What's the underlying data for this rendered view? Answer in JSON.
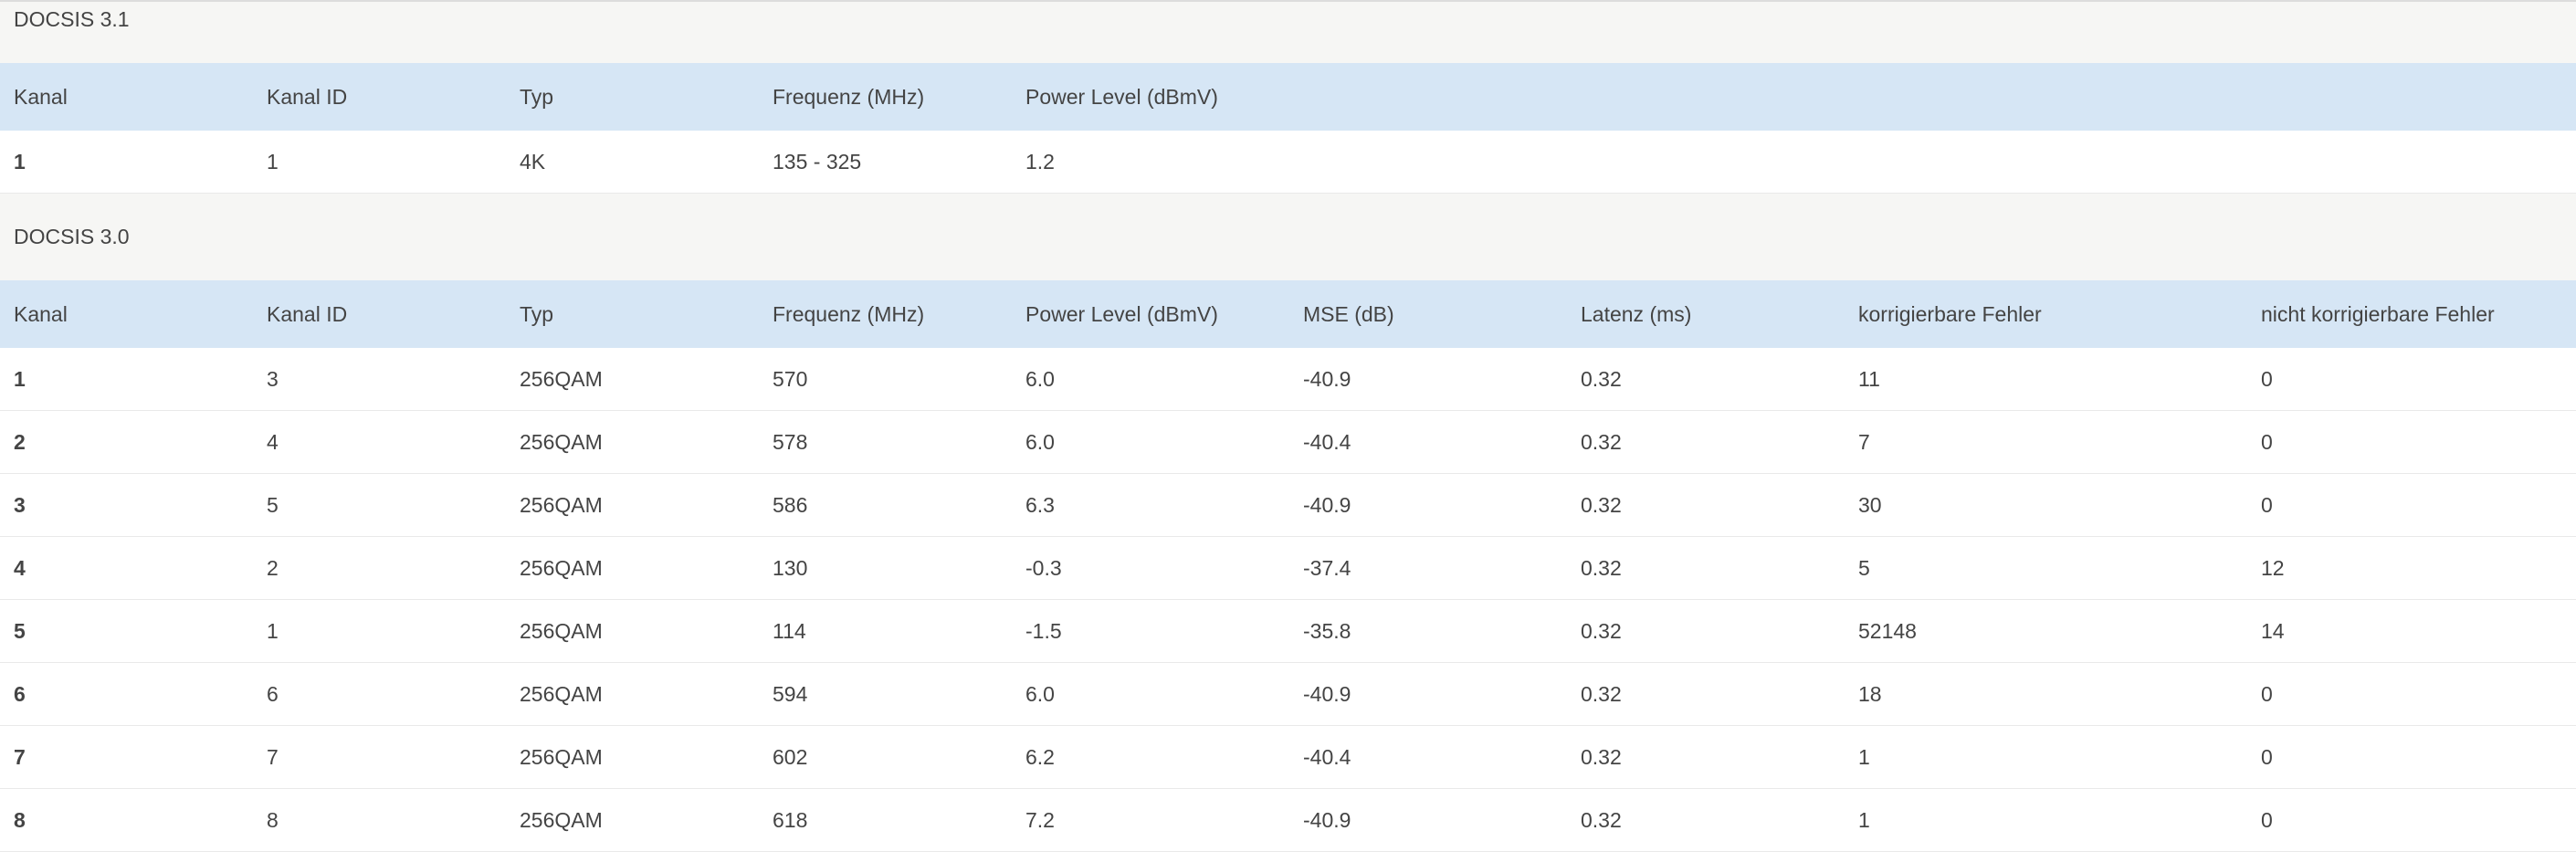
{
  "docsis31": {
    "title": "DOCSIS 3.1",
    "headers": [
      "Kanal",
      "Kanal ID",
      "Typ",
      "Frequenz (MHz)",
      "Power Level (dBmV)"
    ],
    "rows": [
      [
        "1",
        "1",
        "4K",
        "135 - 325",
        "1.2"
      ]
    ]
  },
  "docsis30": {
    "title": "DOCSIS 3.0",
    "headers": [
      "Kanal",
      "Kanal ID",
      "Typ",
      "Frequenz (MHz)",
      "Power Level (dBmV)",
      "MSE (dB)",
      "Latenz (ms)",
      "korrigierbare Fehler",
      "nicht korrigierbare Fehler"
    ],
    "rows": [
      [
        "1",
        "3",
        "256QAM",
        "570",
        "6.0",
        "-40.9",
        "0.32",
        "11",
        "0"
      ],
      [
        "2",
        "4",
        "256QAM",
        "578",
        "6.0",
        "-40.4",
        "0.32",
        "7",
        "0"
      ],
      [
        "3",
        "5",
        "256QAM",
        "586",
        "6.3",
        "-40.9",
        "0.32",
        "30",
        "0"
      ],
      [
        "4",
        "2",
        "256QAM",
        "130",
        "-0.3",
        "-37.4",
        "0.32",
        "5",
        "12"
      ],
      [
        "5",
        "1",
        "256QAM",
        "114",
        "-1.5",
        "-35.8",
        "0.32",
        "52148",
        "14"
      ],
      [
        "6",
        "6",
        "256QAM",
        "594",
        "6.0",
        "-40.9",
        "0.32",
        "18",
        "0"
      ],
      [
        "7",
        "7",
        "256QAM",
        "602",
        "6.2",
        "-40.4",
        "0.32",
        "1",
        "0"
      ],
      [
        "8",
        "8",
        "256QAM",
        "618",
        "7.2",
        "-40.9",
        "0.32",
        "1",
        "0"
      ]
    ]
  }
}
